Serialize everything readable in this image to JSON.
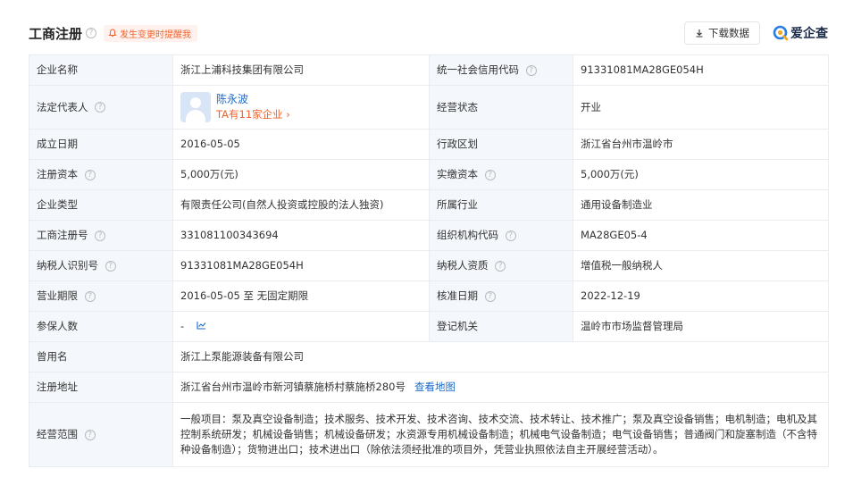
{
  "header": {
    "title": "工商注册",
    "alert": "发生变更时提醒我",
    "download": "下载数据",
    "logo": "爱企查"
  },
  "table": {
    "company_name_label": "企业名称",
    "company_name": "浙江上浦科技集团有限公司",
    "credit_code_label": "统一社会信用代码",
    "credit_code": "91331081MA28GE054H",
    "legal_rep_label": "法定代表人",
    "legal_rep_name": "陈永波",
    "legal_rep_link": "TA有11家企业",
    "status_label": "经营状态",
    "status": "开业",
    "founded_label": "成立日期",
    "founded": "2016-05-05",
    "region_label": "行政区划",
    "region": "浙江省台州市温岭市",
    "reg_capital_label": "注册资本",
    "reg_capital": "5,000万(元)",
    "paid_capital_label": "实缴资本",
    "paid_capital": "5,000万(元)",
    "type_label": "企业类型",
    "type": "有限责任公司(自然人投资或控股的法人独资)",
    "industry_label": "所属行业",
    "industry": "通用设备制造业",
    "reg_no_label": "工商注册号",
    "reg_no": "331081100343694",
    "org_code_label": "组织机构代码",
    "org_code": "MA28GE05-4",
    "taxpayer_id_label": "纳税人识别号",
    "taxpayer_id": "91331081MA28GE054H",
    "taxpayer_qual_label": "纳税人资质",
    "taxpayer_qual": "增值税一般纳税人",
    "term_label": "营业期限",
    "term": "2016-05-05 至 无固定期限",
    "approval_label": "核准日期",
    "approval": "2022-12-19",
    "insured_label": "参保人数",
    "insured": "-",
    "authority_label": "登记机关",
    "authority": "温岭市市场监督管理局",
    "former_name_label": "曾用名",
    "former_name": "浙江上泵能源装备有限公司",
    "address_label": "注册地址",
    "address": "浙江省台州市温岭市新河镇蔡施桥村蔡施桥280号",
    "map_link": "查看地图",
    "scope_label": "经营范围",
    "scope": "一般项目：泵及真空设备制造；技术服务、技术开发、技术咨询、技术交流、技术转让、技术推广；泵及真空设备销售；电机制造；电机及其控制系统研发；机械设备销售；机械设备研发；水资源专用机械设备制造；机械电气设备制造；电气设备销售；普通阀门和旋塞制造（不含特种设备制造）；货物进出口；技术进出口（除依法须经批准的项目外，凭营业执照依法自主开展经营活动）。"
  },
  "colors": {
    "accent": "#1b6ac9",
    "alert": "#f0622d",
    "label_bg": "#f4f7fb",
    "border": "#e9ecf1"
  },
  "icons": [
    "help-icon",
    "bell-icon",
    "download-icon",
    "aiqicha-logo-icon",
    "chevron-right-icon",
    "trend-chart-icon"
  ]
}
